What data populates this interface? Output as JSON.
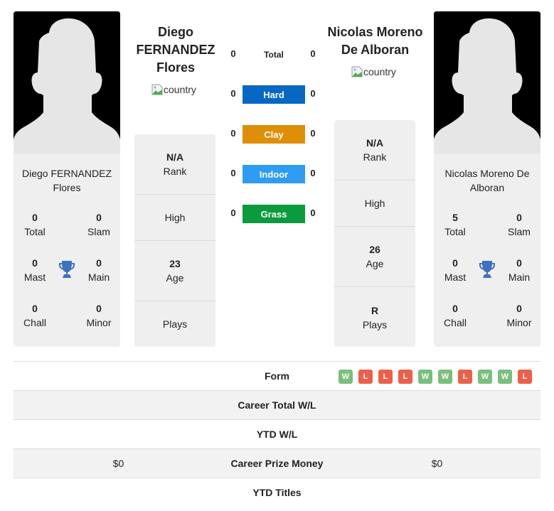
{
  "player1": {
    "header_name": "Diego FERNANDEZ Flores",
    "header_lines": [
      "Diego",
      "FERNANDEZ",
      "Flores"
    ],
    "card_name": "Diego FERNANDEZ Flores",
    "flag_alt": "country",
    "titles": {
      "total": {
        "value": "0",
        "label": "Total"
      },
      "slam": {
        "value": "0",
        "label": "Slam"
      },
      "mast": {
        "value": "0",
        "label": "Mast"
      },
      "main": {
        "value": "0",
        "label": "Main"
      },
      "chall": {
        "value": "0",
        "label": "Chall"
      },
      "minor": {
        "value": "0",
        "label": "Minor"
      }
    },
    "info": {
      "rank": {
        "value": "N/A",
        "label": "Rank"
      },
      "high": {
        "value": "",
        "label": "High"
      },
      "age": {
        "value": "23",
        "label": "Age"
      },
      "plays": {
        "value": "",
        "label": "Plays"
      }
    }
  },
  "player2": {
    "header_name": "Nicolas Moreno De Alboran",
    "header_lines": [
      "Nicolas Moreno",
      "De Alboran"
    ],
    "card_name": "Nicolas Moreno De Alboran",
    "flag_alt": "country",
    "titles": {
      "total": {
        "value": "5",
        "label": "Total"
      },
      "slam": {
        "value": "0",
        "label": "Slam"
      },
      "mast": {
        "value": "0",
        "label": "Mast"
      },
      "main": {
        "value": "0",
        "label": "Main"
      },
      "chall": {
        "value": "0",
        "label": "Chall"
      },
      "minor": {
        "value": "0",
        "label": "Minor"
      }
    },
    "info": {
      "rank": {
        "value": "N/A",
        "label": "Rank"
      },
      "high": {
        "value": "",
        "label": "High"
      },
      "age": {
        "value": "26",
        "label": "Age"
      },
      "plays": {
        "value": "R",
        "label": "Plays"
      }
    }
  },
  "h2h": [
    {
      "label": "Total",
      "p1": "0",
      "p2": "0",
      "color": ""
    },
    {
      "label": "Hard",
      "p1": "0",
      "p2": "0",
      "color": "#0768c4"
    },
    {
      "label": "Clay",
      "p1": "0",
      "p2": "0",
      "color": "#de8e07"
    },
    {
      "label": "Indoor",
      "p1": "0",
      "p2": "0",
      "color": "#2e9cf2"
    },
    {
      "label": "Grass",
      "p1": "0",
      "p2": "0",
      "color": "#0b9a3c"
    }
  ],
  "colors": {
    "win": "#7abf7c",
    "loss": "#ec6049",
    "trophy": "#3c72c0"
  },
  "table": {
    "form_label": "Form",
    "form": [
      "W",
      "L",
      "L",
      "L",
      "W",
      "W",
      "L",
      "W",
      "W",
      "L"
    ],
    "rows": [
      {
        "label": "Career Total W/L",
        "p1": "",
        "p2": ""
      },
      {
        "label": "YTD W/L",
        "p1": "",
        "p2": ""
      },
      {
        "label": "Career Prize Money",
        "p1": "$0",
        "p2": "$0"
      },
      {
        "label": "YTD Titles",
        "p1": "",
        "p2": ""
      }
    ]
  }
}
